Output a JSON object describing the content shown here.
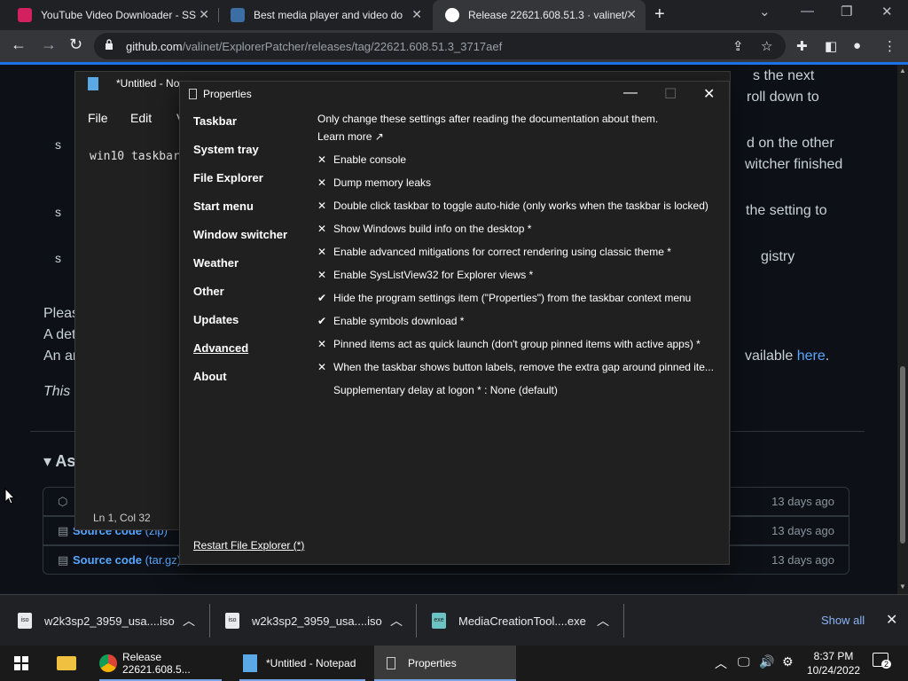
{
  "browser": {
    "tabs": [
      {
        "title": "YouTube Video Downloader - SS",
        "favicon_color": "#d3205e"
      },
      {
        "title": "Best media player and video do",
        "favicon_color": "#3a6ea5"
      },
      {
        "title": "Release 22621.608.51.3 · valinet/",
        "favicon_color": "#ffffff"
      }
    ],
    "new_tab_label": "+",
    "url_domain": "github.com",
    "url_path": "/valinet/ExplorerPatcher/releases/tag/22621.608.51.3_3717aef"
  },
  "page": {
    "lines": [
      {
        "text": "s the next",
        "kind": "text"
      },
      {
        "text": "roll down to",
        "kind": "text"
      },
      {
        "text": "d on the other",
        "kind": "text"
      },
      {
        "text": "witcher finished",
        "kind": "text"
      },
      {
        "text": "the setting to",
        "kind": "text"
      },
      {
        "text": "gistry",
        "kind": "text"
      },
      {
        "text": "Pleas",
        "kind": "text"
      },
      {
        "text": "A det",
        "kind": "text"
      },
      {
        "text": "An ar",
        "kind": "text"
      },
      {
        "text": "vailable ",
        "kind": "text"
      },
      {
        "text": "This",
        "kind": "italic"
      },
      {
        "text": "As",
        "kind": "heading"
      }
    ],
    "here_link": "here",
    "period": ".",
    "bullet_fragments": [
      "s",
      "s",
      "s"
    ],
    "assets": [
      {
        "name": "",
        "suffix": "",
        "date": "13 days ago"
      },
      {
        "name": "Source code",
        "suffix": " (zip)",
        "date": "13 days ago"
      },
      {
        "name": "Source code",
        "suffix": " (tar.gz)",
        "date": "13 days ago"
      }
    ]
  },
  "notepad": {
    "title": "*Untitled - No",
    "menu": [
      "File",
      "Edit",
      "V"
    ],
    "content": "win10 taskbar",
    "status": "Ln 1, Col 32"
  },
  "properties": {
    "title": "Properties",
    "sidebar": [
      {
        "label": "Taskbar",
        "selected": false
      },
      {
        "label": "System tray",
        "selected": false
      },
      {
        "label": "File Explorer",
        "selected": false
      },
      {
        "label": "Start menu",
        "selected": false
      },
      {
        "label": "Window switcher",
        "selected": false
      },
      {
        "label": "Weather",
        "selected": false
      },
      {
        "label": "Other",
        "selected": false
      },
      {
        "label": "Updates",
        "selected": false
      },
      {
        "label": "Advanced",
        "selected": true
      },
      {
        "label": "About",
        "selected": false
      }
    ],
    "description": "Only change these settings after reading the documentation about them.",
    "learn_more": "Learn more ↗",
    "options": [
      {
        "mark": "✕",
        "label": "Enable console"
      },
      {
        "mark": "✕",
        "label": "Dump memory leaks"
      },
      {
        "mark": "✕",
        "label": "Double click taskbar to toggle auto-hide (only works when the taskbar is locked)"
      },
      {
        "mark": "✕",
        "label": "Show Windows build info on the desktop *"
      },
      {
        "mark": "✕",
        "label": "Enable advanced mitigations for correct rendering using classic theme *"
      },
      {
        "mark": "✕",
        "label": "Enable SysListView32 for Explorer views *"
      },
      {
        "mark": "✔",
        "label": "Hide the program settings item (\"Properties\") from the taskbar context menu"
      },
      {
        "mark": "✔",
        "label": "Enable symbols download *"
      },
      {
        "mark": "✕",
        "label": "Pinned items act as quick launch (don't group pinned items with active apps) *"
      },
      {
        "mark": "✕",
        "label": "When the taskbar shows button labels, remove the extra gap around pinned ite..."
      },
      {
        "mark": "",
        "label": "Supplementary delay at logon * : None (default)"
      }
    ],
    "restart_label": "Restart File Explorer (*)"
  },
  "downloads": {
    "items": [
      {
        "name": "w2k3sp2_3959_usa....iso",
        "icon": "iso"
      },
      {
        "name": "w2k3sp2_3959_usa....iso",
        "icon": "iso"
      },
      {
        "name": "MediaCreationTool....exe",
        "icon": "exe"
      }
    ],
    "show_all": "Show all"
  },
  "taskbar": {
    "items": [
      {
        "label": "Release 22621.608.5...",
        "icon": "chrome-icon"
      },
      {
        "label": "*Untitled - Notepad",
        "icon": "notepad-icon"
      },
      {
        "label": "Properties",
        "icon": "properties-icon"
      }
    ],
    "time": "8:37 PM",
    "date": "10/24/2022",
    "notification_count": "2"
  }
}
